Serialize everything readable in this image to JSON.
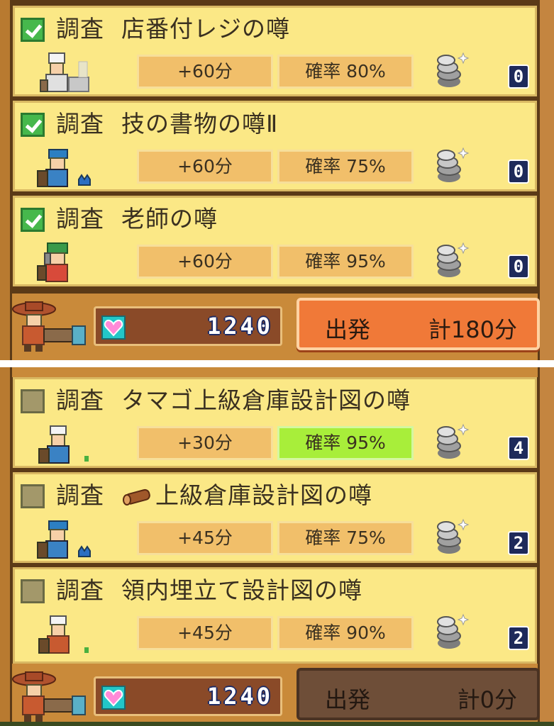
{
  "panels": [
    {
      "id": "top",
      "items": [
        {
          "category": "調査",
          "name": "店番付レジの噂",
          "time": "+60分",
          "rate": "確率 80%",
          "count": "0",
          "checked": true
        },
        {
          "category": "調査",
          "name": "技の書物の噂Ⅱ",
          "time": "+60分",
          "rate": "確率 75%",
          "count": "0",
          "checked": true
        },
        {
          "category": "調査",
          "name": "老師の噂",
          "time": "+60分",
          "rate": "確率 95%",
          "count": "0",
          "checked": true
        }
      ],
      "hearts": "1240",
      "depart_label": "出発",
      "depart_total": "計180分",
      "depart_state": "active"
    },
    {
      "id": "bottom",
      "items": [
        {
          "category": "調査",
          "name": "タマゴ上級倉庫設計図の噂",
          "time": "+30分",
          "rate": "確率 95%",
          "count": "4",
          "checked": false,
          "rate_highlight": true
        },
        {
          "category": "調査",
          "name": "上級倉庫設計図の噂",
          "time": "+45分",
          "rate": "確率 75%",
          "count": "2",
          "checked": false,
          "icon": "wood-log-icon"
        },
        {
          "category": "調査",
          "name": "領内埋立て設計図の噂",
          "time": "+45分",
          "rate": "確率 90%",
          "count": "2",
          "checked": false
        }
      ],
      "hearts": "1240",
      "depart_label": "出発",
      "depart_total": "計0分",
      "depart_state": "inactive"
    }
  ],
  "colors": {
    "card_bg": "#fbe886",
    "chip": "#f1bf6a",
    "rate_highlight": "#a8ee3a",
    "depart_active": "#f07938",
    "depart_inactive": "#6e4e38"
  }
}
